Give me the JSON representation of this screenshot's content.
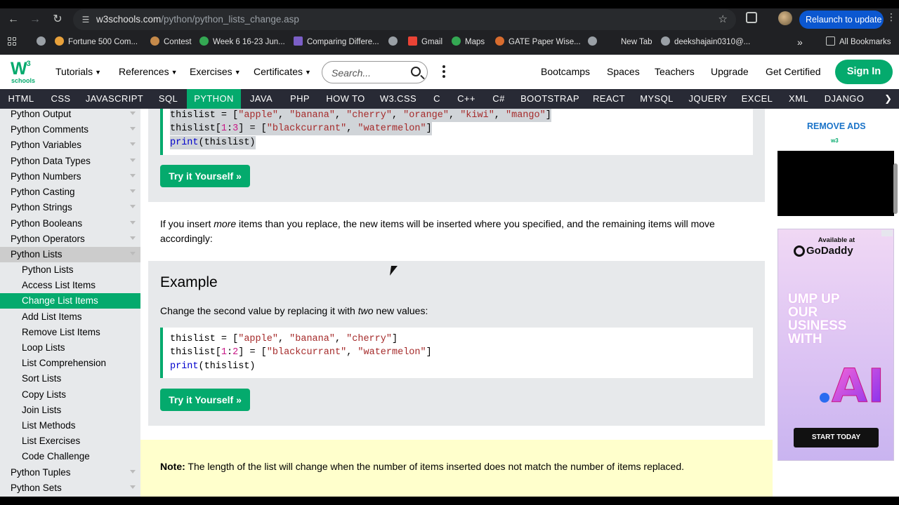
{
  "browser": {
    "url_host": "w3schools.com",
    "url_path": "/python/python_lists_change.asp",
    "relaunch_label": "Relaunch to update",
    "bookmarks": [
      {
        "label": "Fortune 500 Com...",
        "color": "#e8a13b"
      },
      {
        "label": "Contest",
        "color": "#c58a4a"
      },
      {
        "label": "Week 6 16-23 Jun...",
        "color": "#34a853"
      },
      {
        "label": "Comparing Differe...",
        "color": "#7b5fc7"
      },
      {
        "label": "Gmail",
        "color": "#ea4335"
      },
      {
        "label": "Maps",
        "color": "#34a853"
      },
      {
        "label": "GATE Paper Wise...",
        "color": "#d86c2e"
      },
      {
        "label": "New Tab",
        "color": "#9aa0a6"
      },
      {
        "label": "deekshajain0310@...",
        "color": "#9aa0a6"
      }
    ],
    "all_bookmarks_label": "All Bookmarks"
  },
  "header": {
    "logo_text": "W",
    "logo_sup": "3",
    "logo_sub": "schools",
    "menus": [
      "Tutorials",
      "References",
      "Exercises",
      "Certificates"
    ],
    "search_placeholder": "Search...",
    "links": [
      "Bootcamps",
      "Spaces",
      "Teachers",
      "Upgrade",
      "Get Certified"
    ],
    "signin_label": "Sign In"
  },
  "langbar": {
    "items": [
      "HTML",
      "CSS",
      "JAVASCRIPT",
      "SQL",
      "PYTHON",
      "JAVA",
      "PHP",
      "HOW TO",
      "W3.CSS",
      "C",
      "C++",
      "C#",
      "BOOTSTRAP",
      "REACT",
      "MYSQL",
      "JQUERY",
      "EXCEL",
      "XML",
      "DJANGO"
    ],
    "active": "PYTHON"
  },
  "sidebar": {
    "items": [
      {
        "label": "Python Output",
        "level": 0
      },
      {
        "label": "Python Comments",
        "level": 0
      },
      {
        "label": "Python Variables",
        "level": 0
      },
      {
        "label": "Python Data Types",
        "level": 0
      },
      {
        "label": "Python Numbers",
        "level": 0
      },
      {
        "label": "Python Casting",
        "level": 0
      },
      {
        "label": "Python Strings",
        "level": 0
      },
      {
        "label": "Python Booleans",
        "level": 0
      },
      {
        "label": "Python Operators",
        "level": 0
      },
      {
        "label": "Python Lists",
        "level": 0,
        "state": "open"
      },
      {
        "label": "Python Lists",
        "level": 1
      },
      {
        "label": "Access List Items",
        "level": 1
      },
      {
        "label": "Change List Items",
        "level": 1,
        "state": "active"
      },
      {
        "label": "Add List Items",
        "level": 1
      },
      {
        "label": "Remove List Items",
        "level": 1
      },
      {
        "label": "Loop Lists",
        "level": 1
      },
      {
        "label": "List Comprehension",
        "level": 1
      },
      {
        "label": "Sort Lists",
        "level": 1
      },
      {
        "label": "Copy Lists",
        "level": 1
      },
      {
        "label": "Join Lists",
        "level": 1
      },
      {
        "label": "List Methods",
        "level": 1
      },
      {
        "label": "List Exercises",
        "level": 1
      },
      {
        "label": "Code Challenge",
        "level": 1
      },
      {
        "label": "Python Tuples",
        "level": 0
      },
      {
        "label": "Python Sets",
        "level": 0
      }
    ]
  },
  "main": {
    "example1": {
      "code": [
        "thislist = [\"apple\", \"banana\", \"cherry\", \"orange\", \"kiwi\", \"mango\"]",
        "thislist[1:3] = [\"blackcurrant\", \"watermelon\"]",
        "print(thislist)"
      ],
      "try_label": "Try it Yourself »"
    },
    "para_before": "If you insert ",
    "para_em": "more",
    "para_after": " items than you replace, the new items will be inserted where you specified, and the remaining items will move accordingly:",
    "example2": {
      "title": "Example",
      "desc_before": "Change the second value by replacing it with ",
      "desc_em": "two",
      "desc_after": " new values:",
      "code": [
        "thislist = [\"apple\", \"banana\", \"cherry\"]",
        "thislist[1:2] = [\"blackcurrant\", \"watermelon\"]",
        "print(thislist)"
      ],
      "try_label": "Try it Yourself »"
    },
    "note_label": "Note:",
    "note_text": " The length of the list will change when the number of items inserted does not match the number of items replaced."
  },
  "ads": {
    "remove_ads": "REMOVE ADS",
    "mini_logo": "w3",
    "available": "Available at",
    "brand": "GoDaddy",
    "headline": "UMP UP OUR USINESS WITH",
    "ai_text": "AI",
    "cta": "START TODAY"
  }
}
